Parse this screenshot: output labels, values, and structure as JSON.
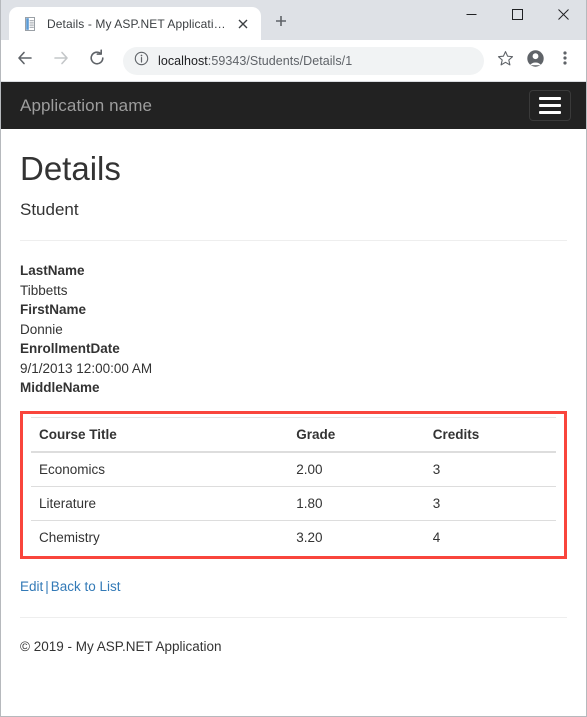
{
  "browser": {
    "tab": {
      "title": "Details - My ASP.NET Application",
      "favicon": "document-icon",
      "close_icon": "close-icon"
    },
    "new_tab_icon": "plus-icon",
    "window_controls": {
      "minimize": "minimize-icon",
      "maximize": "maximize-icon",
      "close": "close-icon"
    },
    "toolbar": {
      "back_icon": "back-arrow-icon",
      "forward_icon": "forward-arrow-icon",
      "reload_icon": "reload-icon",
      "info_icon": "info-circle-icon",
      "url_host": "localhost",
      "url_path": ":59343/Students/Details/1",
      "bookmark_icon": "star-icon",
      "profile_icon": "profile-avatar-icon",
      "menu_icon": "three-dots-menu-icon"
    }
  },
  "navbar": {
    "brand": "Application name",
    "toggle_icon": "hamburger-menu-icon"
  },
  "main": {
    "title": "Details",
    "subtitle": "Student",
    "fields": [
      {
        "label": "LastName",
        "value": "Tibbetts"
      },
      {
        "label": "FirstName",
        "value": "Donnie"
      },
      {
        "label": "EnrollmentDate",
        "value": "9/1/2013 12:00:00 AM"
      },
      {
        "label": "MiddleName",
        "value": ""
      }
    ],
    "enrollments": {
      "highlight_color": "#f9453c",
      "columns": [
        "Course Title",
        "Grade",
        "Credits"
      ],
      "rows": [
        {
          "course": "Economics",
          "grade": "2.00",
          "credits": "3"
        },
        {
          "course": "Literature",
          "grade": "1.80",
          "credits": "3"
        },
        {
          "course": "Chemistry",
          "grade": "3.20",
          "credits": "4"
        }
      ]
    },
    "actions": {
      "edit": "Edit",
      "separator": "|",
      "back": "Back to List"
    },
    "footer": "© 2019 - My ASP.NET Application"
  }
}
